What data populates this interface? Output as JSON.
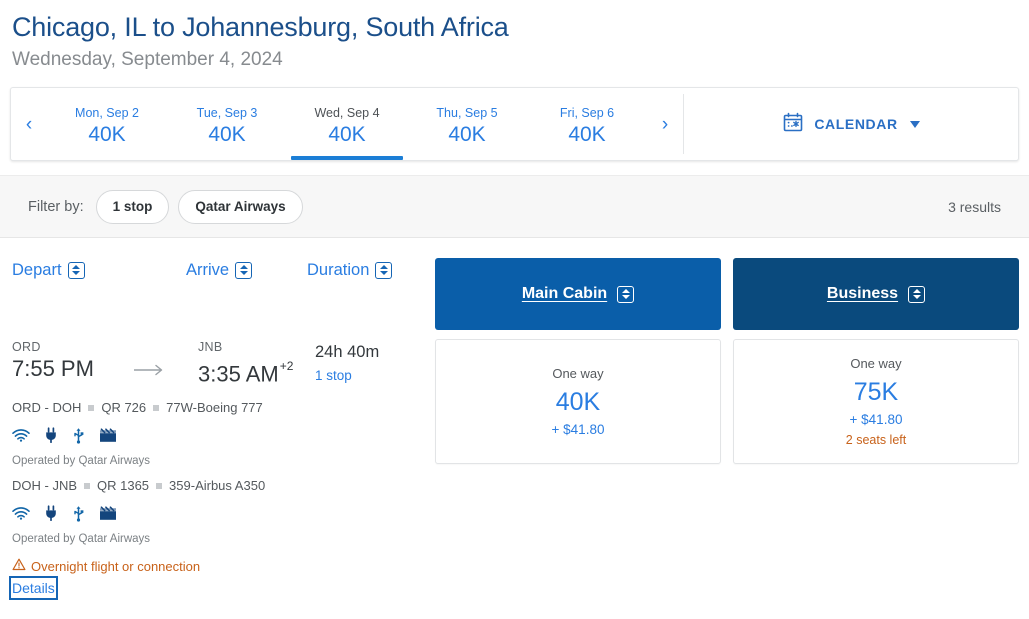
{
  "header": {
    "title": "Chicago, IL to Johannesburg, South Africa",
    "subtitle": "Wednesday, September 4, 2024"
  },
  "date_strip": {
    "prev_icon": "‹",
    "next_icon": "›",
    "dates": [
      {
        "label": "Mon, Sep 2",
        "price": "40K",
        "active": false
      },
      {
        "label": "Tue, Sep 3",
        "price": "40K",
        "active": false
      },
      {
        "label": "Wed, Sep 4",
        "price": "40K",
        "active": true
      },
      {
        "label": "Thu, Sep 5",
        "price": "40K",
        "active": false
      },
      {
        "label": "Fri, Sep 6",
        "price": "40K",
        "active": false
      }
    ],
    "calendar_label": "CALENDAR"
  },
  "filter_bar": {
    "label": "Filter by:",
    "pills": [
      "1 stop",
      "Qatar Airways"
    ],
    "results": "3 results"
  },
  "sort": {
    "depart": "Depart",
    "arrive": "Arrive",
    "duration": "Duration"
  },
  "cabins": [
    {
      "name": "Main Cabin",
      "color": "#0a5ea9"
    },
    {
      "name": "Business",
      "color": "#0a4a7d"
    }
  ],
  "flight": {
    "depart_code": "ORD",
    "depart_time": "7:55 PM",
    "arrive_code": "JNB",
    "arrive_time": "3:35 AM",
    "arrive_day_offset": "+2",
    "duration": "24h 40m",
    "stops": "1 stop",
    "legs": [
      {
        "route": "ORD - DOH",
        "flight_no": "QR 726",
        "aircraft": "77W-Boeing 777",
        "amenities": [
          "wifi-icon",
          "power-icon",
          "usb-icon",
          "entertainment-icon"
        ],
        "operated_by": "Operated by Qatar Airways"
      },
      {
        "route": "DOH - JNB",
        "flight_no": "QR 1365",
        "aircraft": "359-Airbus A350",
        "amenities": [
          "wifi-icon",
          "power-icon",
          "usb-icon",
          "entertainment-icon"
        ],
        "operated_by": "Operated by Qatar Airways"
      }
    ],
    "warning": "Overnight flight or connection",
    "details_label": "Details"
  },
  "fares": [
    {
      "one_way": "One way",
      "miles": "40K",
      "fee": "+ $41.80",
      "seats_left": ""
    },
    {
      "one_way": "One way",
      "miles": "75K",
      "fee": "+ $41.80",
      "seats_left": "2 seats left"
    }
  ],
  "colors": {
    "brand_blue": "#2a7de1",
    "main_cabin": "#0a5ea9",
    "business": "#0a4a7d",
    "warning": "#c8621a",
    "title": "#1b4f8a"
  }
}
